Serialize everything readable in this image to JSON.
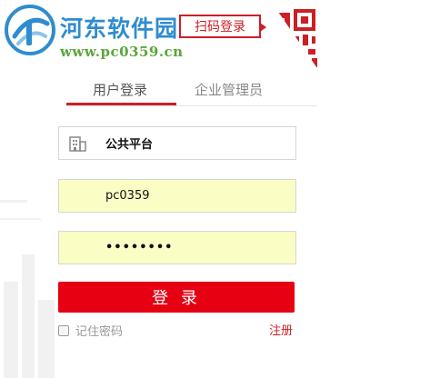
{
  "watermark": {
    "title": "河东软件园",
    "url": "www.pc0359.cn"
  },
  "scan_login": {
    "label": "扫码登录"
  },
  "tabs": [
    {
      "label": "用户登录",
      "active": true
    },
    {
      "label": "企业管理员",
      "active": false
    }
  ],
  "form": {
    "org": {
      "icon": "building-icon",
      "value": "公共平台"
    },
    "username": {
      "value": "pc0359"
    },
    "password": {
      "value": "••••••••"
    }
  },
  "login_button": {
    "label": "登 录"
  },
  "remember": {
    "label": "记住密码",
    "checked": false
  },
  "register_link": {
    "label": "注册"
  },
  "colors": {
    "accent": "#e60012",
    "autofill": "#fafec4",
    "watermark_blue": "#2f8ccf",
    "watermark_green": "#5aa63a"
  }
}
